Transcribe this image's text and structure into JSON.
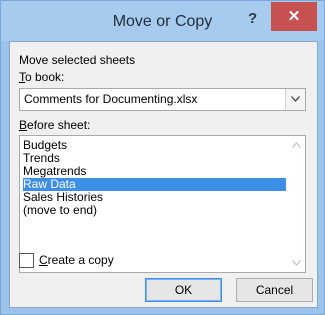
{
  "window": {
    "title": "Move or Copy",
    "help_label": "?",
    "close_label": "✕"
  },
  "form": {
    "move_label": "Move selected sheets",
    "to_book_label": "To book:",
    "book_value": "Comments for Documenting.xlsx",
    "before_sheet_label": "Before sheet:",
    "sheets": [
      "Budgets",
      "Trends",
      "Megatrends",
      "Raw Data",
      "Sales Histories",
      "(move to end)"
    ],
    "selected_sheet": "Raw Data",
    "create_copy_label": "Create a copy",
    "create_copy_checked": false
  },
  "buttons": {
    "ok": "OK",
    "cancel": "Cancel"
  },
  "icons": {
    "dropdown": "chevron-down-icon",
    "scroll_up": "scroll-up-icon",
    "scroll_down": "scroll-down-icon",
    "close": "close-icon",
    "help": "help-icon"
  }
}
